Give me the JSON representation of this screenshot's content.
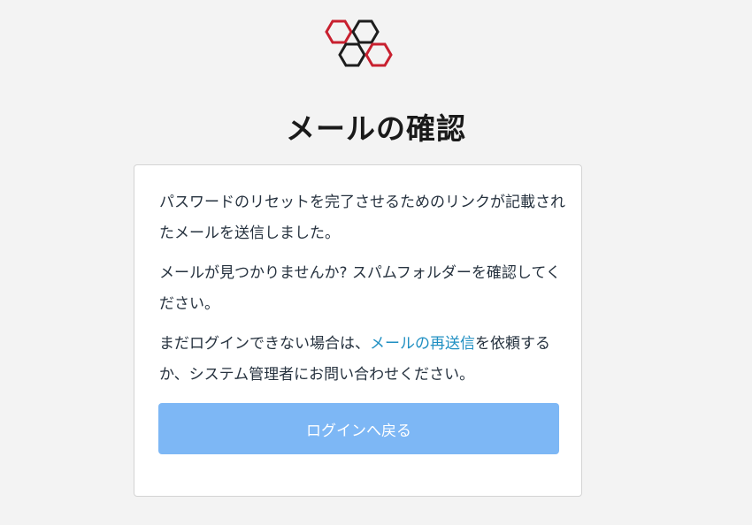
{
  "header": {
    "title": "メールの確認"
  },
  "message": {
    "paragraph1": "パスワードのリセットを完了させるためのリンクが記載されたメールを送信しました。",
    "paragraph2": "メールが見つかりませんか? スパムフォルダーを確認してください。",
    "paragraph3_before": "まだログインできない場合は、",
    "paragraph3_link": "メールの再送信",
    "paragraph3_after": "を依頼するか、システム管理者にお問い合わせください。"
  },
  "actions": {
    "back_to_login_label": "ログインへ戻る"
  },
  "logo": {
    "icon": "hexagon-cluster-logo",
    "colors": [
      "#c8202f",
      "#1d1d1d"
    ]
  },
  "colors": {
    "button": "#7db7f5",
    "link": "#1f8fc2",
    "text": "#26323f",
    "background": "#f3f3f3"
  }
}
